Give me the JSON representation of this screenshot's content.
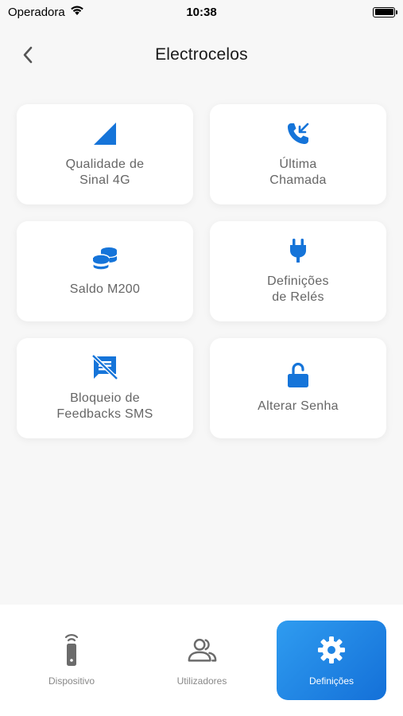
{
  "status_bar": {
    "carrier": "Operadora",
    "time": "10:38"
  },
  "header": {
    "title": "Electrocelos"
  },
  "colors": {
    "accent": "#1574d9",
    "card_text": "#666666",
    "tab_active_start": "#2f9cf0",
    "tab_active_end": "#1470d8"
  },
  "menu": {
    "items": [
      {
        "label": "Qualidade de\nSinal 4G",
        "icon": "signal-icon"
      },
      {
        "label": "Última\nChamada",
        "icon": "phone-incoming-icon"
      },
      {
        "label": "Saldo M200",
        "icon": "coins-icon"
      },
      {
        "label": "Definições\nde Relés",
        "icon": "plug-icon"
      },
      {
        "label": "Bloqueio de\nFeedbacks SMS",
        "icon": "sms-blocked-icon"
      },
      {
        "label": "Alterar Senha",
        "icon": "lock-open-icon"
      }
    ]
  },
  "tab_bar": {
    "tabs": [
      {
        "label": "Dispositivo",
        "icon": "remote-icon",
        "active": false
      },
      {
        "label": "Utilizadores",
        "icon": "users-icon",
        "active": false
      },
      {
        "label": "Definições",
        "icon": "gear-icon",
        "active": true
      }
    ]
  }
}
